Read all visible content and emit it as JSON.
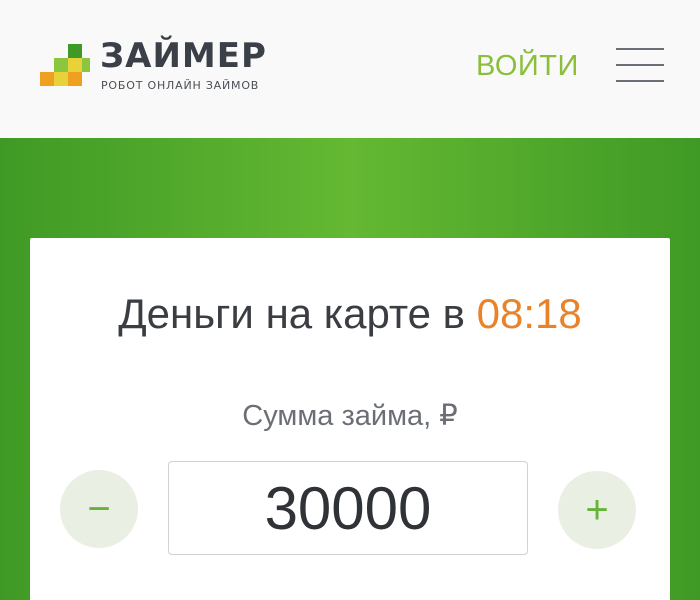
{
  "header": {
    "logo_title": "ЗАЙМЕР",
    "logo_subtitle": "РОБОТ ОНЛАЙН ЗАЙМОВ",
    "login_label": "ВОЙТИ",
    "menu_icon": "hamburger-menu-icon"
  },
  "calculator": {
    "headline_text": "Деньги на карте в",
    "headline_time": "08:18",
    "amount_label": "Сумма займа, ₽",
    "amount_value": "30000",
    "minus_label": "−",
    "plus_label": "+"
  },
  "colors": {
    "brand_green": "#64b832",
    "accent_orange": "#e8832a",
    "logo_orange": "#f0a020",
    "logo_yellow": "#e8d23a",
    "logo_green": "#3f9a25",
    "text_dark": "#3a3d42"
  }
}
